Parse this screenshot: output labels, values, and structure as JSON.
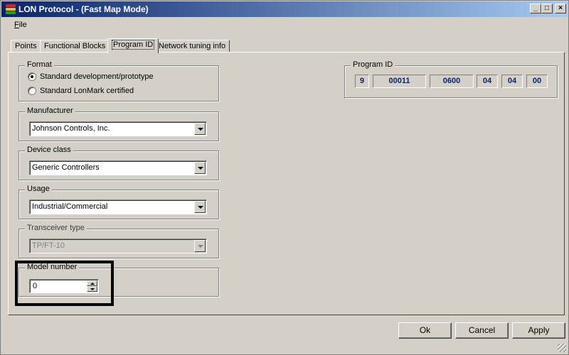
{
  "window": {
    "title": "LON Protocol - (Fast Map Mode)"
  },
  "menu": {
    "file_prefix": "F",
    "file_rest": "ile"
  },
  "tabs": [
    {
      "label": "Points"
    },
    {
      "label": "Functional Blocks"
    },
    {
      "label": "Program ID"
    },
    {
      "label": "Network tuning info"
    }
  ],
  "format": {
    "label": "Format",
    "option1": "Standard development/prototype",
    "option2": "Standard LonMark certified"
  },
  "manufacturer": {
    "label": "Manufacturer",
    "value": "Johnson Controls, Inc."
  },
  "device_class": {
    "label": "Device class",
    "value": "Generic Controllers"
  },
  "usage": {
    "label": "Usage",
    "value": "Industrial/Commercial"
  },
  "transceiver": {
    "label": "Transceiver type",
    "value": "TP/FT-10"
  },
  "model": {
    "label": "Model number",
    "value": "0"
  },
  "program_id": {
    "label": "Program ID",
    "cells": [
      "9",
      "00011",
      "0600",
      "04",
      "04",
      "00"
    ]
  },
  "buttons": {
    "ok": "Ok",
    "cancel": "Cancel",
    "apply": "Apply"
  },
  "colors": {
    "title_start": "#0a246a",
    "title_end": "#a6caf0",
    "pid_text": "#0a246a"
  }
}
